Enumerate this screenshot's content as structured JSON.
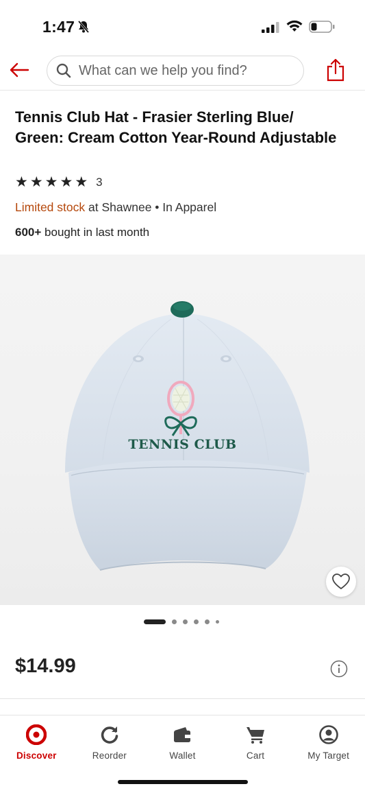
{
  "status_bar": {
    "time": "1:47"
  },
  "search": {
    "placeholder": "What can we help you find?"
  },
  "product": {
    "title": "Tennis Club Hat - Frasier Sterling Blue/ Green: Cream Cotton Year-Round Adjustable",
    "rating_stars": 5,
    "rating_count": "3",
    "stock_status": "Limited stock",
    "stock_location": "at Shawnee • In Apparel",
    "bought_count": "600+",
    "bought_text": "bought in last month",
    "image_text": "TENNIS CLUB",
    "price": "$14.99",
    "image_count": 6,
    "current_image": 1
  },
  "nav": {
    "items": [
      {
        "label": "Discover",
        "icon": "target-logo-icon",
        "active": true
      },
      {
        "label": "Reorder",
        "icon": "reorder-icon",
        "active": false
      },
      {
        "label": "Wallet",
        "icon": "wallet-icon",
        "active": false
      },
      {
        "label": "Cart",
        "icon": "cart-icon",
        "active": false
      },
      {
        "label": "My Target",
        "icon": "account-icon",
        "active": false
      }
    ]
  },
  "colors": {
    "accent": "#cc0000",
    "stock": "#b5480c",
    "hat": "#dde6ef",
    "button": "#1e6b5a"
  }
}
